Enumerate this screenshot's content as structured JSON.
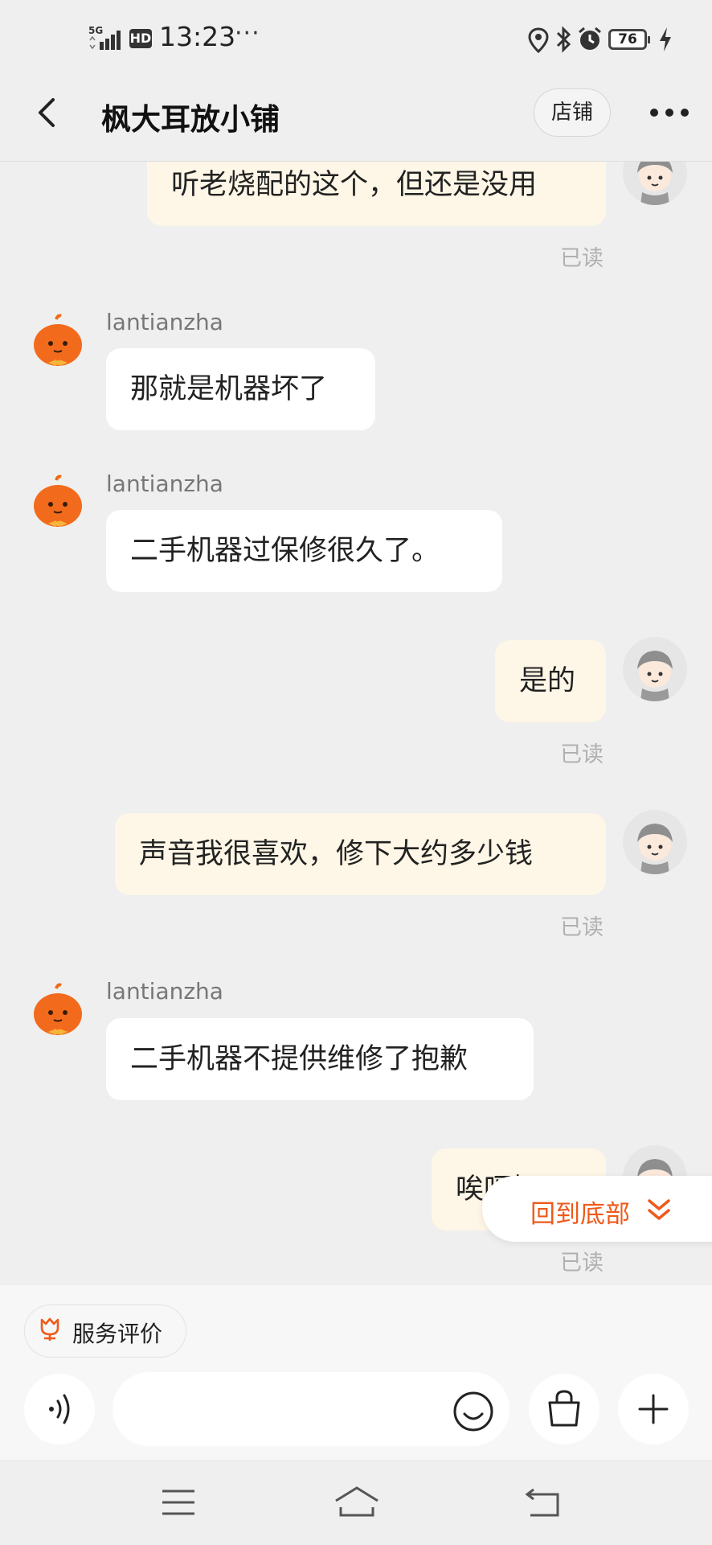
{
  "status_bar": {
    "network": "5G",
    "hd": "HD",
    "time": "13:23",
    "more": "···",
    "battery": "76"
  },
  "header": {
    "title": "枫大耳放小铺",
    "shop_button": "店铺"
  },
  "messages": [
    {
      "from": "me",
      "text": "听老烧配的这个，但还是没用",
      "status": "已读"
    },
    {
      "from": "them",
      "user": "lantianzha",
      "text": "那就是机器坏了"
    },
    {
      "from": "them",
      "user": "lantianzha",
      "text": "二手机器过保修很久了。"
    },
    {
      "from": "me",
      "text": "是的",
      "status": "已读"
    },
    {
      "from": "me",
      "text": "声音我很喜欢，修下大约多少钱",
      "status": "已读"
    },
    {
      "from": "them",
      "user": "lantianzha",
      "text": "二手机器不提供维修了抱歉"
    },
    {
      "from": "me",
      "text": "唉呀妈呀",
      "status": "已读"
    }
  ],
  "jump_to_bottom": "回到底部",
  "bottom": {
    "review_label": "服务评价",
    "input_placeholder": "",
    "input_value": ""
  },
  "colors": {
    "accent": "#ee5a1b",
    "my_bubble": "#fef6e6",
    "their_bubble": "#ffffff",
    "background": "#efefef"
  },
  "icons": {
    "back": "chevron-left-icon",
    "more": "more-dots-icon",
    "voice": "voice-icon",
    "emoji": "emoji-icon",
    "shopping_bag": "shopping-bag-icon",
    "plus": "plus-icon",
    "review": "tulip-icon",
    "nav_menu": "menu-icon",
    "nav_home": "home-icon",
    "nav_back": "return-icon"
  }
}
